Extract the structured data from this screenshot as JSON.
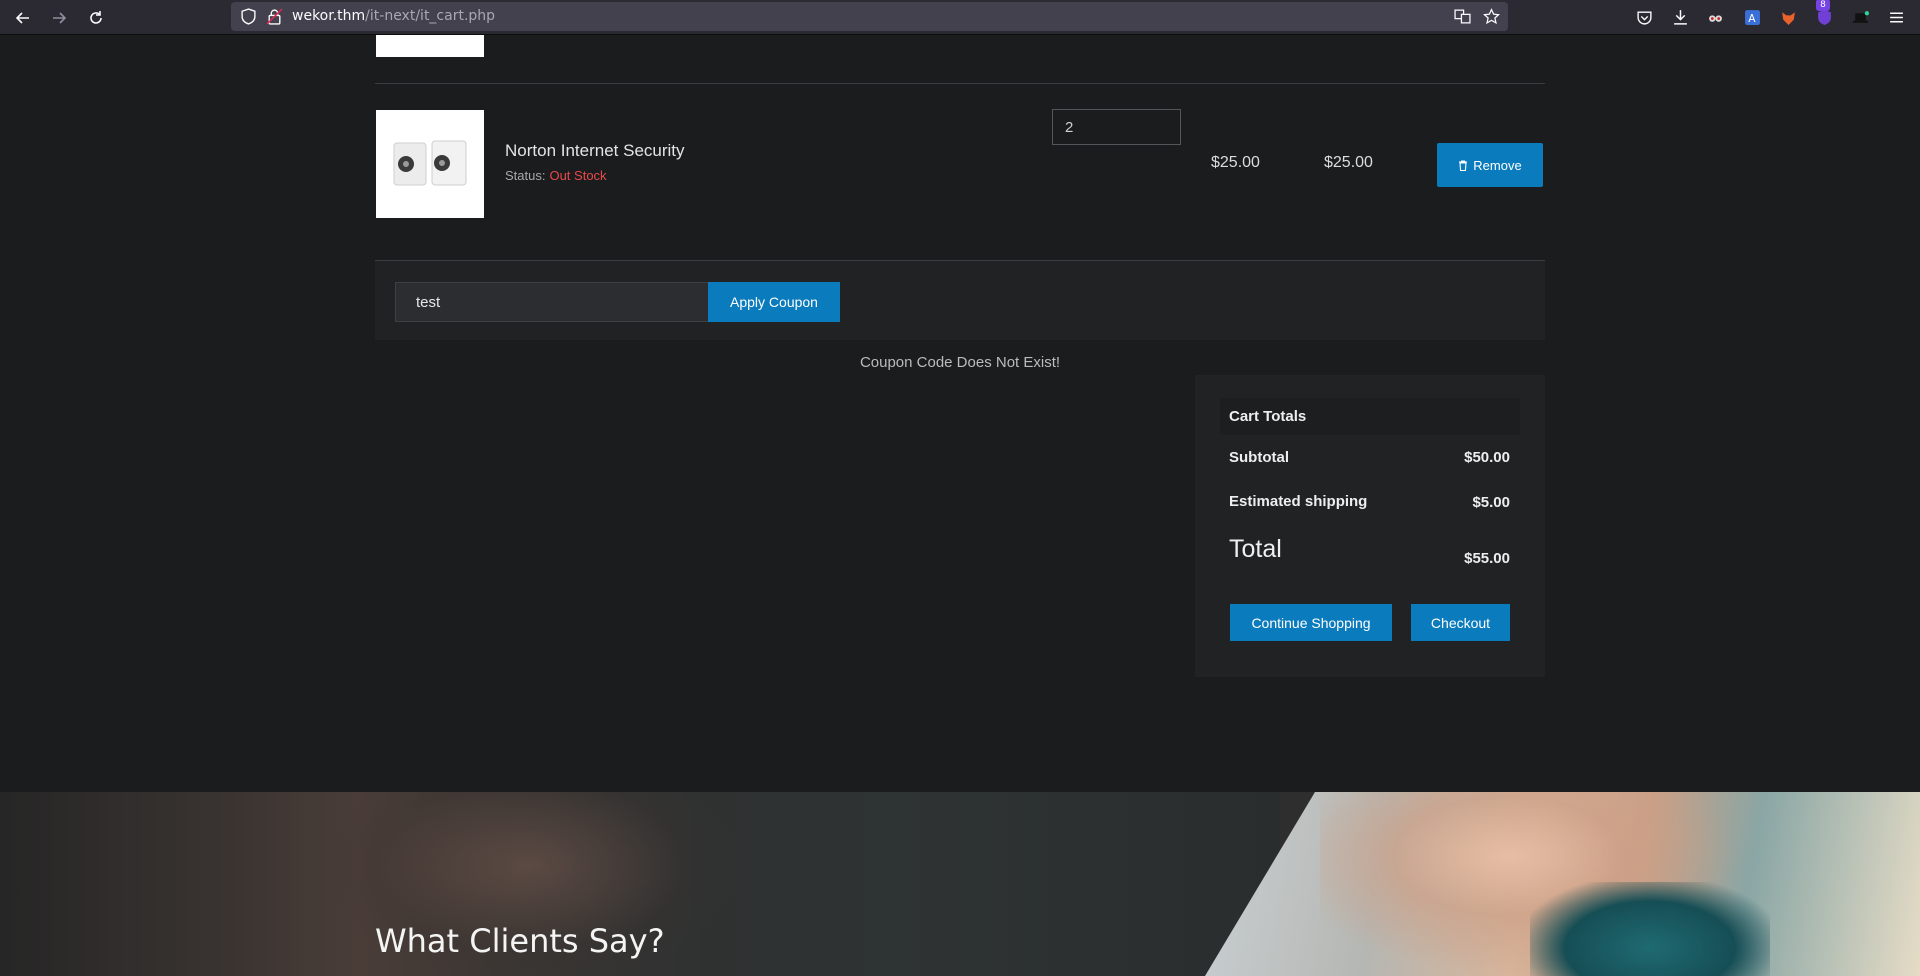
{
  "browser": {
    "url_host": "wekor.thm",
    "url_path": "/it-next/it_cart.php",
    "extension_badge": "8"
  },
  "cart": {
    "item": {
      "name": "Norton Internet Security",
      "status_label": "Status:",
      "status_value": "Out Stock",
      "quantity": "2",
      "unit_price": "$25.00",
      "line_total": "$25.00",
      "remove_label": "Remove"
    },
    "coupon": {
      "value": "test",
      "apply_label": "Apply Coupon",
      "message": "Coupon Code Does Not Exist!"
    },
    "totals": {
      "heading": "Cart Totals",
      "subtotal_label": "Subtotal",
      "subtotal_value": "$50.00",
      "shipping_label": "Estimated shipping",
      "shipping_value": "$5.00",
      "total_label": "Total",
      "total_value": "$55.00",
      "continue_label": "Continue Shopping",
      "checkout_label": "Checkout"
    }
  },
  "testimonials": {
    "title": "What Clients Say?"
  },
  "colors": {
    "accent": "#0a7bbd",
    "out_of_stock": "#e84a4a",
    "page_bg": "#1b1c1e"
  }
}
